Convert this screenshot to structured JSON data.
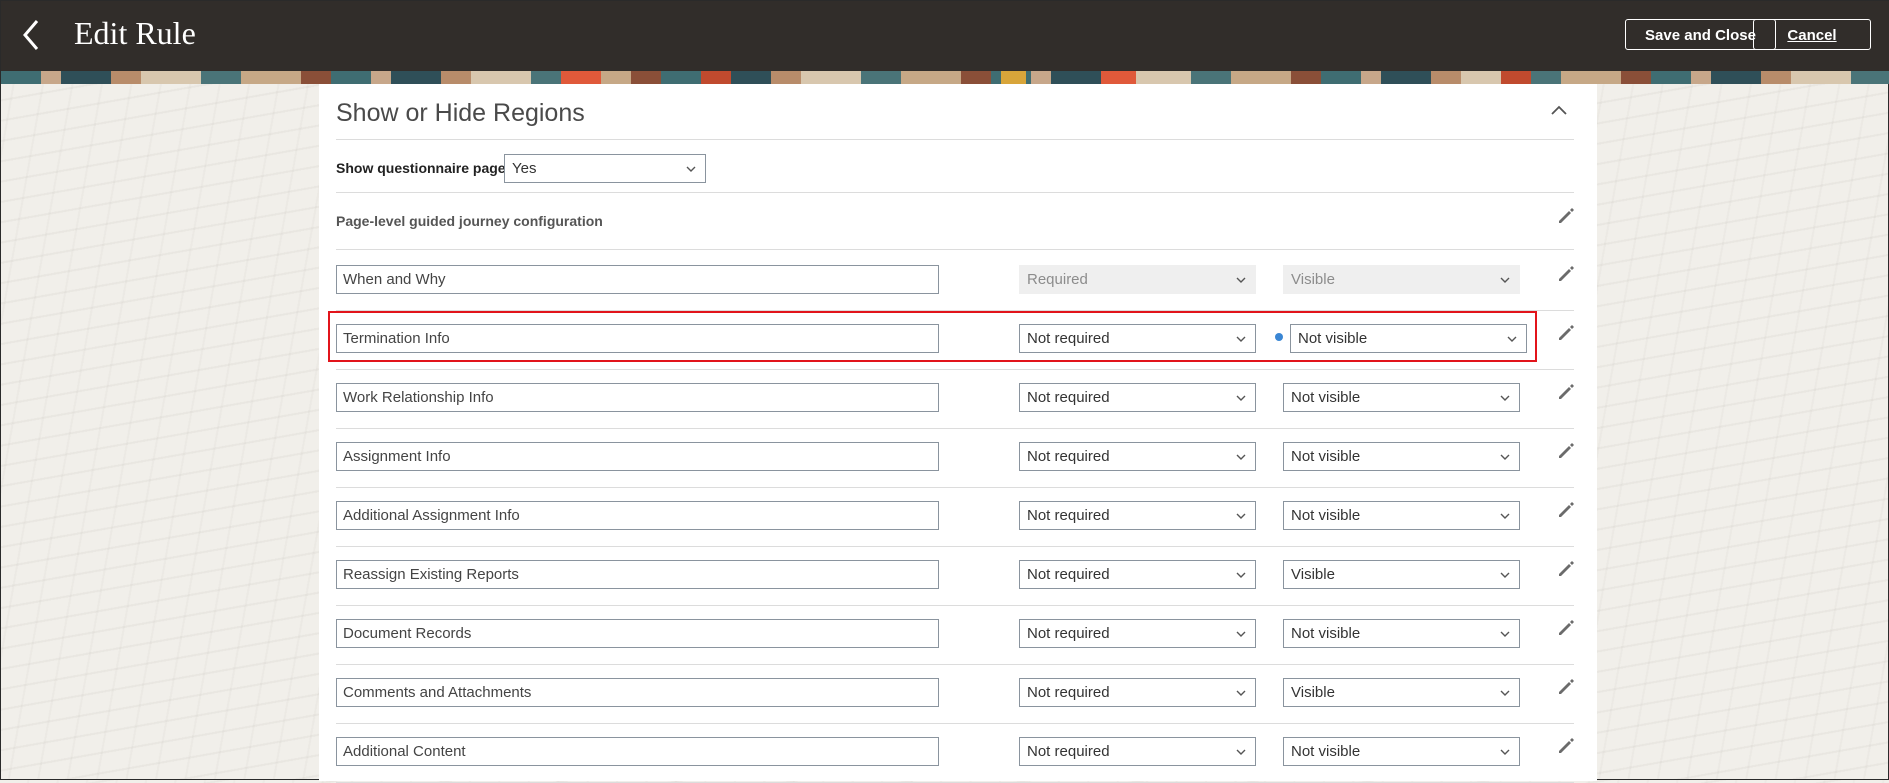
{
  "header": {
    "title": "Edit Rule",
    "save_label": "Save and Close",
    "cancel_label": "Cancel"
  },
  "section": {
    "title": "Show or Hide Regions",
    "questionnaire_label": "Show questionnaire page",
    "questionnaire_value": "Yes",
    "journey_label": "Page-level guided journey configuration"
  },
  "rows": [
    {
      "name": "When and Why",
      "required": "Required",
      "visibility": "Visible"
    },
    {
      "name": "Termination Info",
      "required": "Not required",
      "visibility": "Not visible"
    },
    {
      "name": "Work Relationship Info",
      "required": "Not required",
      "visibility": "Not visible"
    },
    {
      "name": "Assignment Info",
      "required": "Not required",
      "visibility": "Not visible"
    },
    {
      "name": "Additional Assignment Info",
      "required": "Not required",
      "visibility": "Not visible"
    },
    {
      "name": "Reassign Existing Reports",
      "required": "Not required",
      "visibility": "Visible"
    },
    {
      "name": "Document Records",
      "required": "Not required",
      "visibility": "Not visible"
    },
    {
      "name": "Comments and Attachments",
      "required": "Not required",
      "visibility": "Visible"
    },
    {
      "name": "Additional Content",
      "required": "Not required",
      "visibility": "Not visible"
    }
  ],
  "icons": {
    "back": "chevron-left-icon",
    "collapse": "chevron-up-icon",
    "edit": "pencil-icon",
    "dropdown": "chevron-down-icon"
  },
  "colors": {
    "header_bg": "#312d2a",
    "highlight": "#e2141b",
    "modified_dot": "#3a86d4"
  }
}
